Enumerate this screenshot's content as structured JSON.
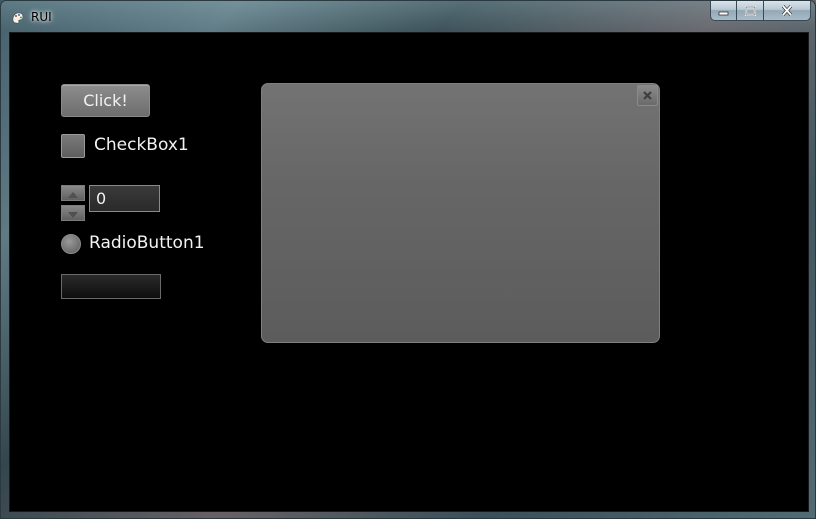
{
  "window": {
    "title": "RUI",
    "icons": {
      "app": "paint-palette-icon",
      "minimize": "minimize-icon",
      "maximize": "maximize-icon",
      "close": "close-icon"
    }
  },
  "controls": {
    "button_label": "Click!",
    "checkbox_label": "CheckBox1",
    "checkbox_checked": false,
    "spinner_value": "0",
    "radio_label": "RadioButton1",
    "radio_selected": false,
    "textfield_value": ""
  },
  "panel": {
    "close_icon": "close-icon"
  },
  "colors": {
    "client_bg": "#000000",
    "widget_gray": "#6e6e6e",
    "text": "#f2f2f2"
  }
}
